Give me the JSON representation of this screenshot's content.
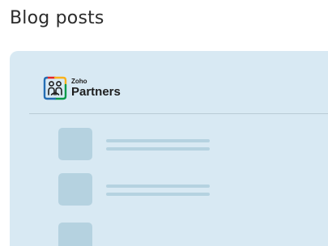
{
  "page": {
    "heading": "Blog posts"
  },
  "brand": {
    "small_label": "Zoho",
    "name": "Partners",
    "logo_icon": "zoho-partners-logo-icon",
    "logo_colors": [
      "#e42527",
      "#f9b21d",
      "#089949",
      "#226db4"
    ]
  },
  "placeholder_rows": [
    {
      "kind": "post-skeleton"
    },
    {
      "kind": "post-skeleton"
    },
    {
      "kind": "post-skeleton"
    }
  ],
  "colors": {
    "card_background": "#d8e9f3",
    "skeleton": "#b5d2e0",
    "divider": "#b9cbd6",
    "heading_text": "#2b2b2b"
  }
}
